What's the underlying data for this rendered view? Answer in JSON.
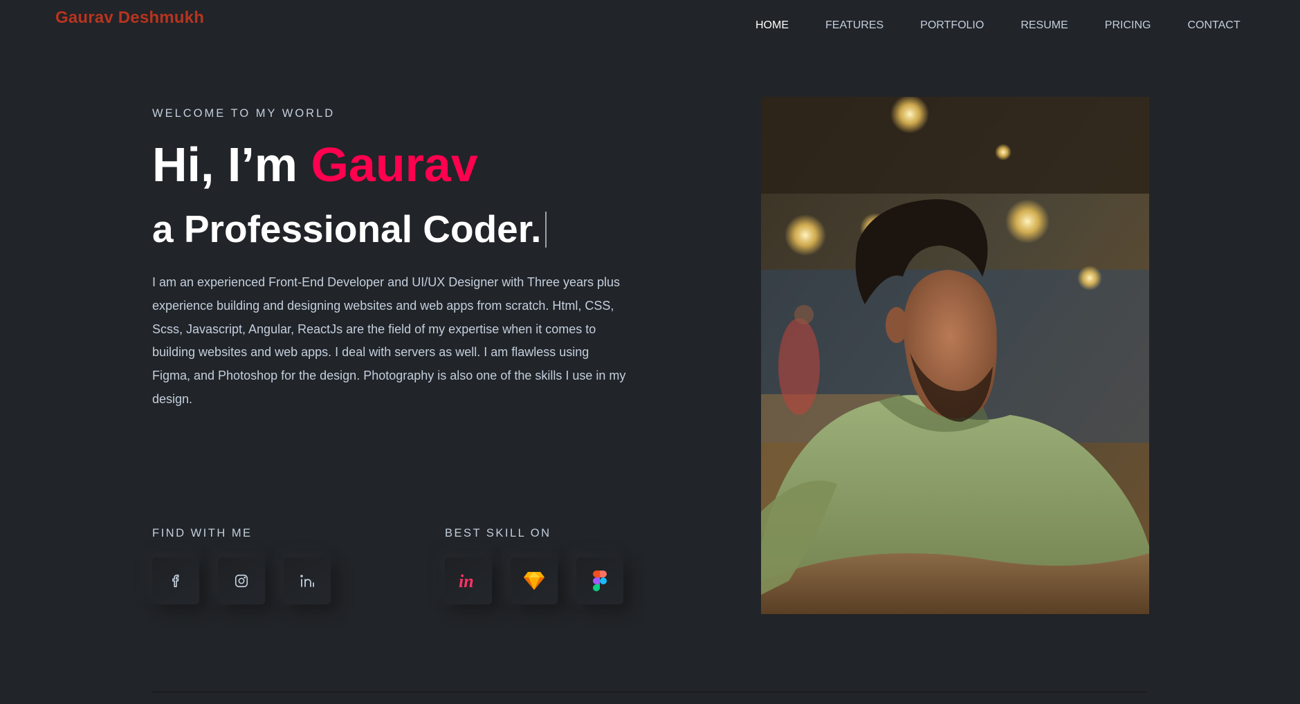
{
  "header": {
    "brand": "Gaurav Deshmukh",
    "nav": [
      {
        "label": "HOME",
        "active": true
      },
      {
        "label": "FEATURES",
        "active": false
      },
      {
        "label": "PORTFOLIO",
        "active": false
      },
      {
        "label": "RESUME",
        "active": false
      },
      {
        "label": "PRICING",
        "active": false
      },
      {
        "label": "CONTACT",
        "active": false
      }
    ]
  },
  "hero": {
    "eyebrow": "WELCOME TO MY WORLD",
    "greeting": "Hi, I’m ",
    "name": "Gaurav",
    "role": "a Professional Coder.",
    "bio": "I am an experienced Front-End Developer and UI/UX Designer with Three years plus experience building and designing websites and web apps from scratch. Html, CSS, Scss, Javascript, Angular, ReactJs are the field of my expertise when it comes to building websites and web apps. I deal with servers as well. I am flawless using Figma, and Photoshop for the design. Photography is also one of the skills I use in my design."
  },
  "find_with_me": {
    "label": "FIND WITH ME",
    "icons": [
      "facebook-icon",
      "instagram-icon",
      "linkedin-icon"
    ]
  },
  "best_skill_on": {
    "label": "BEST SKILL ON",
    "icons": [
      "invision-icon",
      "sketch-icon",
      "figma-icon"
    ]
  },
  "colors": {
    "background": "#212428",
    "accent": "#ff014f",
    "brand": "#b8341f",
    "text": "#c4cfde"
  }
}
